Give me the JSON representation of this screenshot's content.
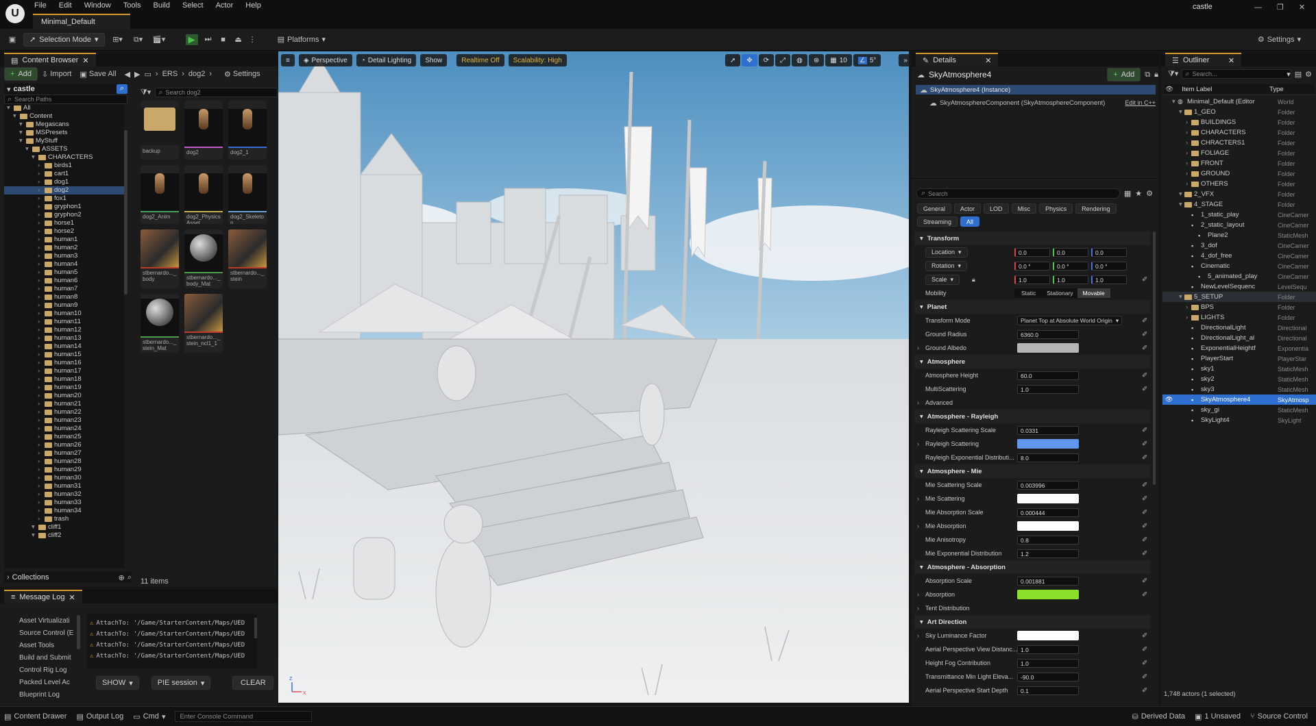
{
  "menu": [
    "File",
    "Edit",
    "Window",
    "Tools",
    "Build",
    "Select",
    "Actor",
    "Help"
  ],
  "map_tab": "Minimal_Default",
  "project": "castle",
  "toolbar": {
    "selection_mode": "Selection Mode",
    "platforms": "Platforms",
    "settings": "Settings"
  },
  "content_browser": {
    "tab": "Content Browser",
    "add": "Add",
    "import": "Import",
    "save_all": "Save All",
    "path": [
      "ERS",
      "dog2"
    ],
    "settings": "Settings",
    "root": "castle",
    "search_paths_placeholder": "Search Paths",
    "search_placeholder": "Search dog2",
    "tree": [
      {
        "label": "All",
        "depth": 0
      },
      {
        "label": "Content",
        "depth": 1
      },
      {
        "label": "Megascans",
        "depth": 2
      },
      {
        "label": "MSPresets",
        "depth": 2
      },
      {
        "label": "MyStuff",
        "depth": 2
      },
      {
        "label": "ASSETS",
        "depth": 3
      },
      {
        "label": "CHARACTERS",
        "depth": 4
      },
      {
        "label": "birds1",
        "depth": 5
      },
      {
        "label": "cart1",
        "depth": 5
      },
      {
        "label": "dog1",
        "depth": 5
      },
      {
        "label": "dog2",
        "depth": 5,
        "selected": true
      },
      {
        "label": "fox1",
        "depth": 5
      },
      {
        "label": "gryphon1",
        "depth": 5
      },
      {
        "label": "gryphon2",
        "depth": 5
      },
      {
        "label": "horse1",
        "depth": 5
      },
      {
        "label": "horse2",
        "depth": 5
      },
      {
        "label": "human1",
        "depth": 5
      },
      {
        "label": "human2",
        "depth": 5
      },
      {
        "label": "human3",
        "depth": 5
      },
      {
        "label": "human4",
        "depth": 5
      },
      {
        "label": "human5",
        "depth": 5
      },
      {
        "label": "human6",
        "depth": 5
      },
      {
        "label": "human7",
        "depth": 5
      },
      {
        "label": "human8",
        "depth": 5
      },
      {
        "label": "human9",
        "depth": 5
      },
      {
        "label": "human10",
        "depth": 5
      },
      {
        "label": "human11",
        "depth": 5
      },
      {
        "label": "human12",
        "depth": 5
      },
      {
        "label": "human13",
        "depth": 5
      },
      {
        "label": "human14",
        "depth": 5
      },
      {
        "label": "human15",
        "depth": 5
      },
      {
        "label": "human16",
        "depth": 5
      },
      {
        "label": "human17",
        "depth": 5
      },
      {
        "label": "human18",
        "depth": 5
      },
      {
        "label": "human19",
        "depth": 5
      },
      {
        "label": "human20",
        "depth": 5
      },
      {
        "label": "human21",
        "depth": 5
      },
      {
        "label": "human22",
        "depth": 5
      },
      {
        "label": "human23",
        "depth": 5
      },
      {
        "label": "human24",
        "depth": 5
      },
      {
        "label": "human25",
        "depth": 5
      },
      {
        "label": "human26",
        "depth": 5
      },
      {
        "label": "human27",
        "depth": 5
      },
      {
        "label": "human28",
        "depth": 5
      },
      {
        "label": "human29",
        "depth": 5
      },
      {
        "label": "human30",
        "depth": 5
      },
      {
        "label": "human31",
        "depth": 5
      },
      {
        "label": "human32",
        "depth": 5
      },
      {
        "label": "human33",
        "depth": 5
      },
      {
        "label": "human34",
        "depth": 5
      },
      {
        "label": "trash",
        "depth": 5
      },
      {
        "label": "cliff1",
        "depth": 4
      },
      {
        "label": "cliff2",
        "depth": 4
      }
    ],
    "assets": [
      {
        "label": "backup",
        "kind": "folder"
      },
      {
        "label": "dog2",
        "kind": "mesh",
        "accent": "#c25bc9"
      },
      {
        "label": "dog2_1",
        "kind": "mesh",
        "accent": "#3c6bd6"
      },
      {
        "label": "dog2_Anim",
        "kind": "anim",
        "accent": "#49a15a"
      },
      {
        "label": "dog2_PhysicsAsset",
        "kind": "mesh",
        "accent": "#c2b34a"
      },
      {
        "label": "dog2_Skeleton",
        "kind": "mesh",
        "accent": "#6aa2d8"
      },
      {
        "label": "stbernardo..._body",
        "kind": "tex",
        "accent": "#c0392b"
      },
      {
        "label": "stbernardo..._body_Mat",
        "kind": "mat",
        "accent": "#4aa04a"
      },
      {
        "label": "stbernardo..._stein",
        "kind": "tex",
        "accent": "#c0392b"
      },
      {
        "label": "stbernardo..._stein_Mat",
        "kind": "mat",
        "accent": "#4aa04a"
      },
      {
        "label": "stbernardo..._stein_ncl1_1",
        "kind": "tex",
        "accent": "#c0392b"
      }
    ],
    "collections": "Collections",
    "count": "11 items"
  },
  "message_log": {
    "tab": "Message Log",
    "categories": [
      "Asset Virtualizati",
      "Source Control (E",
      "Asset Tools",
      "Build and Submit",
      "Control Rig Log",
      "Packed Level Ac",
      "Blueprint Log"
    ],
    "messages": [
      "AttachTo: '/Game/StarterContent/Maps/UED",
      "AttachTo: '/Game/StarterContent/Maps/UED",
      "AttachTo: '/Game/StarterContent/Maps/UED",
      "AttachTo: '/Game/StarterContent/Maps/UED"
    ],
    "show": "SHOW",
    "pie": "PIE session",
    "clear": "CLEAR"
  },
  "viewport": {
    "perspective": "Perspective",
    "lighting": "Detail Lighting",
    "show": "Show",
    "realtime": "Realtime Off",
    "scalability": "Scalability: High",
    "grid_snap": "10",
    "rot_snap": "5°"
  },
  "details": {
    "tab": "Details",
    "actor": "SkyAtmosphere4",
    "add": "Add",
    "instance": "SkyAtmosphere4 (Instance)",
    "component": "SkyAtmosphereComponent (SkyAtmosphereComponent)",
    "edit_cpp": "Edit in C++",
    "search_placeholder": "Search",
    "filters_row1": [
      "General",
      "Actor",
      "LOD",
      "Misc",
      "Physics",
      "Rendering"
    ],
    "filters_row2": [
      "Streaming",
      "All"
    ],
    "transform": {
      "title": "Transform",
      "location_label": "Location",
      "location": [
        "0.0",
        "0.0",
        "0.0"
      ],
      "rotation_label": "Rotation",
      "rotation": [
        "0.0 °",
        "0.0 °",
        "0.0 °"
      ],
      "scale_label": "Scale",
      "scale": [
        "1.0",
        "1.0",
        "1.0"
      ],
      "mobility_label": "Mobility",
      "mobility": [
        "Static",
        "Stationary",
        "Movable"
      ]
    },
    "sections": [
      {
        "title": "Planet",
        "props": [
          {
            "label": "Transform Mode",
            "type": "dropdown",
            "value": "Planet Top at Absolute World Origin"
          },
          {
            "label": "Ground Radius",
            "type": "field",
            "value": "6360.0"
          },
          {
            "label": "Ground Albedo",
            "type": "color",
            "color": "#b5b5b5",
            "expand": true
          }
        ]
      },
      {
        "title": "Atmosphere",
        "props": [
          {
            "label": "Atmosphere Height",
            "type": "field",
            "value": "60.0"
          },
          {
            "label": "MultiScattering",
            "type": "field",
            "value": "1.0"
          },
          {
            "label": "Advanced",
            "type": "group",
            "expand": true
          }
        ]
      },
      {
        "title": "Atmosphere - Rayleigh",
        "props": [
          {
            "label": "Rayleigh Scattering Scale",
            "type": "field",
            "value": "0.0331"
          },
          {
            "label": "Rayleigh Scattering",
            "type": "color",
            "color": "#5f97f0",
            "expand": true
          },
          {
            "label": "Rayleigh Exponential Distributi...",
            "type": "field",
            "value": "8.0"
          }
        ]
      },
      {
        "title": "Atmosphere - Mie",
        "props": [
          {
            "label": "Mie Scattering Scale",
            "type": "field",
            "value": "0.003996"
          },
          {
            "label": "Mie Scattering",
            "type": "color",
            "color": "#ffffff",
            "expand": true
          },
          {
            "label": "Mie Absorption Scale",
            "type": "field",
            "value": "0.000444"
          },
          {
            "label": "Mie Absorption",
            "type": "color",
            "color": "#ffffff",
            "expand": true
          },
          {
            "label": "Mie Anisotropy",
            "type": "field",
            "value": "0.8"
          },
          {
            "label": "Mie Exponential Distribution",
            "type": "field",
            "value": "1.2"
          }
        ]
      },
      {
        "title": "Atmosphere - Absorption",
        "props": [
          {
            "label": "Absorption Scale",
            "type": "field",
            "value": "0.001881"
          },
          {
            "label": "Absorption",
            "type": "color",
            "color": "#8be02a",
            "expand": true
          },
          {
            "label": "Tent Distribution",
            "type": "group",
            "expand": true
          }
        ]
      },
      {
        "title": "Art Direction",
        "props": [
          {
            "label": "Sky Luminance Factor",
            "type": "color",
            "color": "#ffffff",
            "expand": true
          },
          {
            "label": "Aerial Perspective View Distanc...",
            "type": "field",
            "value": "1.0"
          },
          {
            "label": "Height Fog Contribution",
            "type": "field",
            "value": "1.0"
          },
          {
            "label": "Transmittance Min Light Eleva...",
            "type": "field",
            "value": "-90.0"
          },
          {
            "label": "Aerial Perspective Start Depth",
            "type": "field",
            "value": "0.1"
          }
        ]
      }
    ]
  },
  "outliner": {
    "tab": "Outliner",
    "search_placeholder": "Search...",
    "col_label": "Item Label",
    "col_type": "Type",
    "rows": [
      {
        "label": "Minimal_Default (Editor",
        "type": "World",
        "depth": 0,
        "kind": "world"
      },
      {
        "label": "1_GEO",
        "type": "Folder",
        "depth": 1,
        "kind": "folder"
      },
      {
        "label": "BUILDINGS",
        "type": "Folder",
        "depth": 2,
        "kind": "folder"
      },
      {
        "label": "CHARACTERS",
        "type": "Folder",
        "depth": 2,
        "kind": "folder"
      },
      {
        "label": "CHRACTERS1",
        "type": "Folder",
        "depth": 2,
        "kind": "folder"
      },
      {
        "label": "FOLIAGE",
        "type": "Folder",
        "depth": 2,
        "kind": "folder"
      },
      {
        "label": "FRONT",
        "type": "Folder",
        "depth": 2,
        "kind": "folder"
      },
      {
        "label": "GROUND",
        "type": "Folder",
        "depth": 2,
        "kind": "folder"
      },
      {
        "label": "OTHERS",
        "type": "Folder",
        "depth": 2,
        "kind": "folder"
      },
      {
        "label": "2_VFX",
        "type": "Folder",
        "depth": 1,
        "kind": "folder"
      },
      {
        "label": "4_STAGE",
        "type": "Folder",
        "depth": 1,
        "kind": "folder"
      },
      {
        "label": "1_static_play",
        "type": "CineCamer",
        "depth": 2,
        "kind": "actor"
      },
      {
        "label": "2_static_layout",
        "type": "CineCamer",
        "depth": 2,
        "kind": "actor"
      },
      {
        "label": "Plane2",
        "type": "StaticMesh",
        "depth": 3,
        "kind": "actor"
      },
      {
        "label": "3_dof",
        "type": "CineCamer",
        "depth": 2,
        "kind": "actor"
      },
      {
        "label": "4_dof_free",
        "type": "CineCamer",
        "depth": 2,
        "kind": "actor"
      },
      {
        "label": "Cinematic",
        "type": "CineCamer",
        "depth": 2,
        "kind": "actor"
      },
      {
        "label": "5_animated_play",
        "type": "CineCamer",
        "depth": 3,
        "kind": "actor"
      },
      {
        "label": "NewLevelSequenc",
        "type": "LevelSequ",
        "depth": 2,
        "kind": "actor"
      },
      {
        "label": "5_SETUP",
        "type": "Folder",
        "depth": 1,
        "kind": "folder",
        "band": true
      },
      {
        "label": "BPS",
        "type": "Folder",
        "depth": 2,
        "kind": "folder"
      },
      {
        "label": "LIGHTS",
        "type": "Folder",
        "depth": 2,
        "kind": "folder"
      },
      {
        "label": "DirectionalLight",
        "type": "Directional",
        "depth": 2,
        "kind": "actor"
      },
      {
        "label": "DirectionalLight_al",
        "type": "Directional",
        "depth": 2,
        "kind": "actor"
      },
      {
        "label": "ExponentialHeightf",
        "type": "Exponentia",
        "depth": 2,
        "kind": "actor"
      },
      {
        "label": "PlayerStart",
        "type": "PlayerStar",
        "depth": 2,
        "kind": "actor"
      },
      {
        "label": "sky1",
        "type": "StaticMesh",
        "depth": 2,
        "kind": "actor"
      },
      {
        "label": "sky2",
        "type": "StaticMesh",
        "depth": 2,
        "kind": "actor"
      },
      {
        "label": "sky3",
        "type": "StaticMesh",
        "depth": 2,
        "kind": "actor"
      },
      {
        "label": "SkyAtmosphere4",
        "type": "SkyAtmosp",
        "depth": 2,
        "kind": "actor",
        "selected": true
      },
      {
        "label": "sky_gi",
        "type": "StaticMesh",
        "depth": 2,
        "kind": "actor"
      },
      {
        "label": "SkyLight4",
        "type": "SkyLight",
        "depth": 2,
        "kind": "actor"
      }
    ],
    "footer": "1,748 actors (1 selected)"
  },
  "statusbar": {
    "content_drawer": "Content Drawer",
    "output_log": "Output Log",
    "cmd": "Cmd",
    "console_placeholder": "Enter Console Command",
    "derived_data": "Derived Data",
    "unsaved": "1 Unsaved",
    "source_control": "Source Control"
  }
}
